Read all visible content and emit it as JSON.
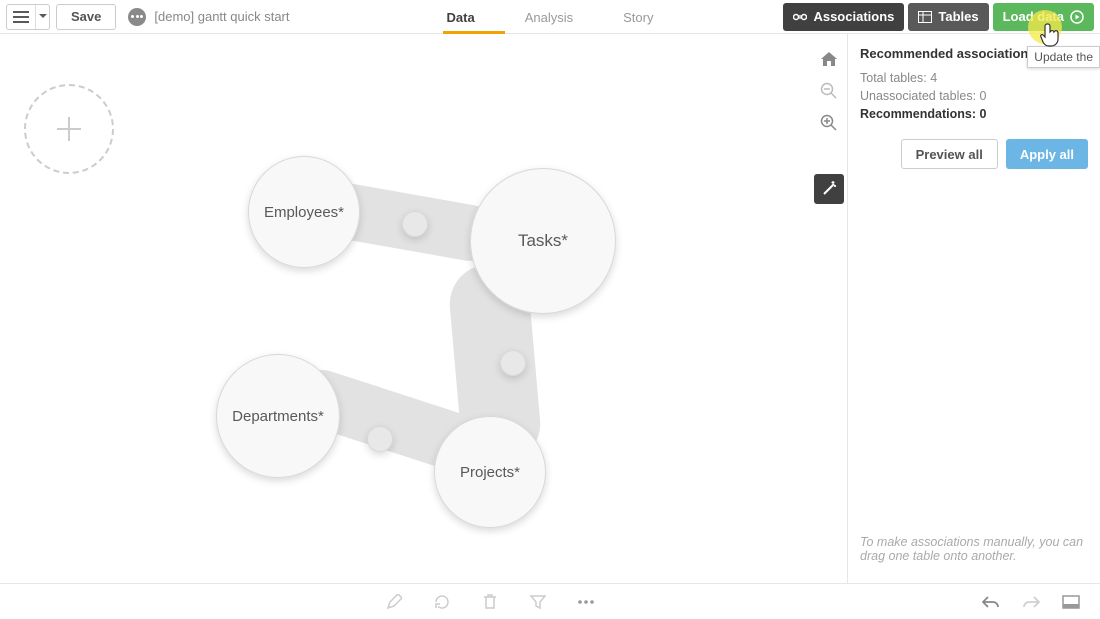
{
  "header": {
    "save_label": "Save",
    "app_name": "[demo] gantt quick start",
    "tabs": {
      "data": "Data",
      "analysis": "Analysis",
      "story": "Story"
    },
    "associations_label": "Associations",
    "tables_label": "Tables",
    "load_data_label": "Load data",
    "tooltip_text": "Update the"
  },
  "bubbles": {
    "employees": "Employees*",
    "tasks": "Tasks*",
    "departments": "Departments*",
    "projects": "Projects*"
  },
  "panel": {
    "title": "Recommended associations",
    "total_tables_label": "Total tables:",
    "total_tables_value": "4",
    "unassociated_label": "Unassociated tables:",
    "unassociated_value": "0",
    "recommendations_label": "Recommendations:",
    "recommendations_value": "0",
    "preview_label": "Preview all",
    "apply_label": "Apply all",
    "hint": "To make associations manually, you can drag one table onto another."
  }
}
